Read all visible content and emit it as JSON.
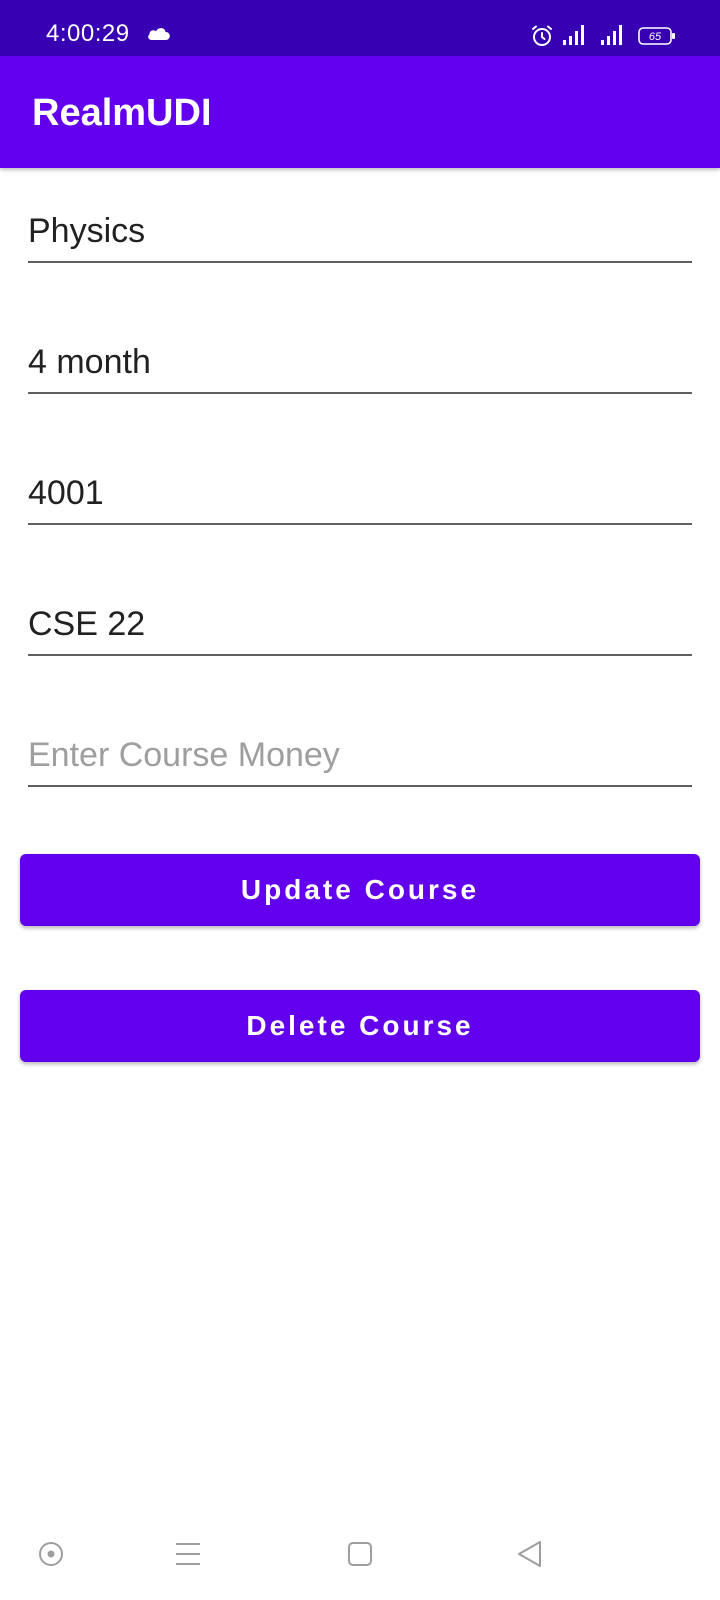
{
  "status_bar": {
    "time": "4:00:29",
    "battery": "65",
    "icons": [
      "cloud-icon",
      "alarm-icon",
      "signal-icon",
      "signal-icon",
      "battery-icon"
    ]
  },
  "app_bar": {
    "title": "RealmUDI",
    "color": "#6200ee"
  },
  "form": {
    "course_name": {
      "value": "Physics"
    },
    "course_duration": {
      "value": "4 month"
    },
    "course_id": {
      "value": "4001"
    },
    "course_track": {
      "value": "CSE 22"
    },
    "course_money": {
      "value": "",
      "placeholder": "Enter Course Money"
    }
  },
  "buttons": {
    "update_label": "Update Course",
    "delete_label": "Delete Course"
  },
  "nav_bar": {
    "icons": [
      "assistant-icon",
      "menu-icon",
      "home-icon",
      "back-icon"
    ]
  },
  "colors": {
    "status_bar": "#3700b3",
    "primary": "#6200ee",
    "underline": "#5f5f5f",
    "placeholder": "#9e9e9e"
  }
}
